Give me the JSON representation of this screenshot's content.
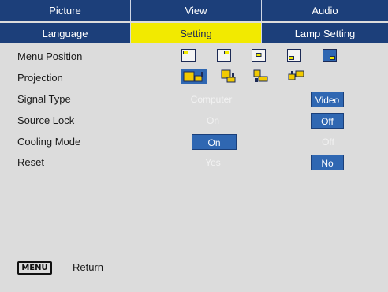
{
  "tabs_top": [
    {
      "label": "Picture"
    },
    {
      "label": "View"
    },
    {
      "label": "Audio"
    }
  ],
  "tabs_sub": [
    {
      "label": "Language"
    },
    {
      "label": "Setting"
    },
    {
      "label": "Lamp Setting"
    }
  ],
  "rows": {
    "menu_position": {
      "label": "Menu Position"
    },
    "projection": {
      "label": "Projection"
    },
    "signal_type": {
      "label": "Signal Type",
      "options": [
        "Computer",
        "Video"
      ],
      "selected": "Video"
    },
    "source_lock": {
      "label": "Source Lock",
      "options": [
        "On",
        "Off"
      ],
      "selected": "Off"
    },
    "cooling_mode": {
      "label": "Cooling Mode",
      "options": [
        "On",
        "Off"
      ],
      "selected": "On"
    },
    "reset": {
      "label": "Reset",
      "options": [
        "Yes",
        "No"
      ],
      "selected": "No"
    }
  },
  "footer": {
    "menu_key": "MENU",
    "return_label": "Return"
  },
  "colors": {
    "tab_bg": "#1c3f7a",
    "tab_active_bg": "#f2ea00",
    "selected_bg": "#2f67b2",
    "panel_bg": "#dcdcdc",
    "projection_icon": "#f2ca00"
  }
}
